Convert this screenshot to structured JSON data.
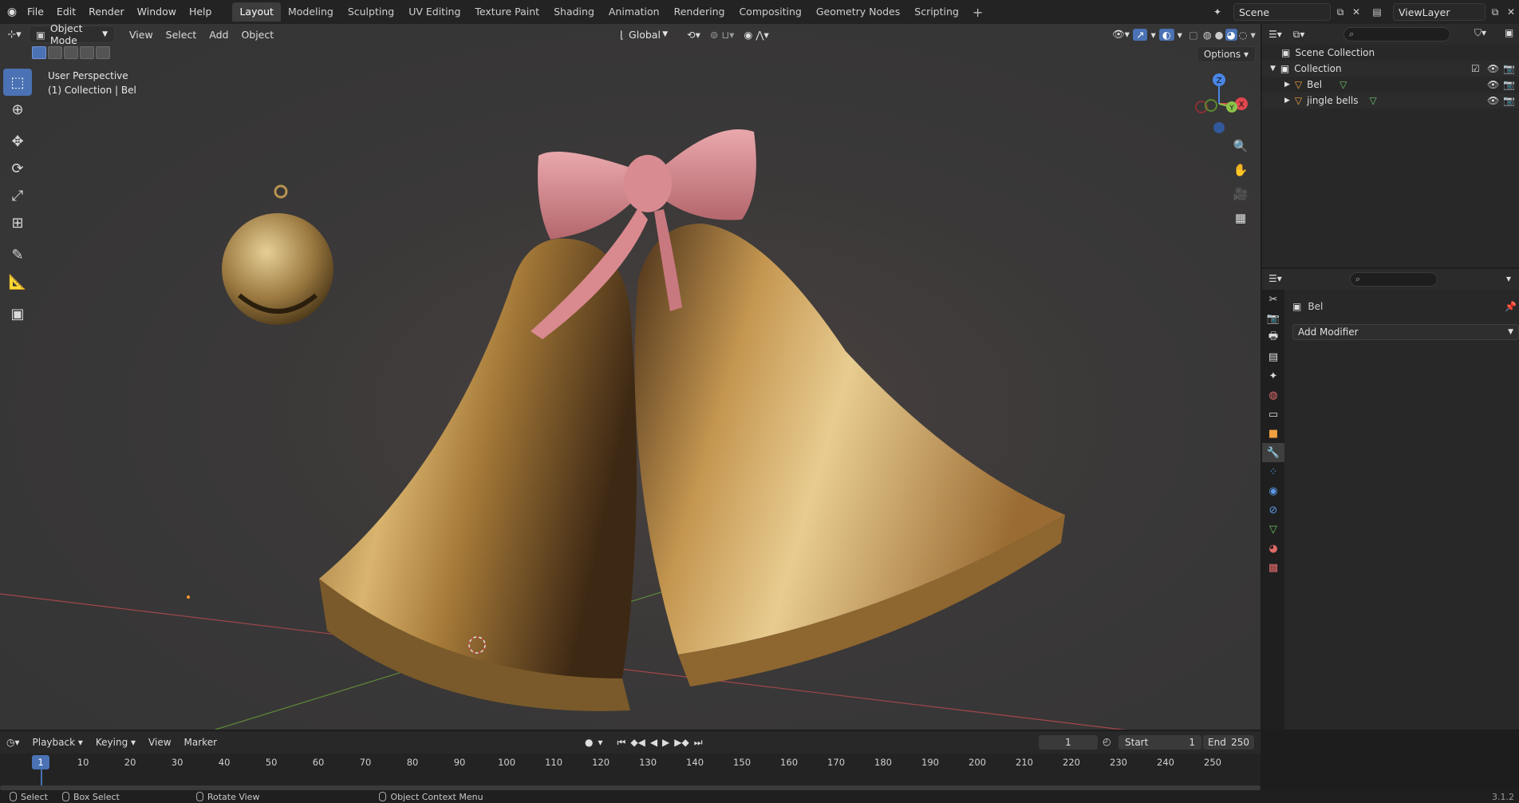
{
  "topbar": {
    "menus": [
      "File",
      "Edit",
      "Render",
      "Window",
      "Help"
    ],
    "workspaces": [
      "Layout",
      "Modeling",
      "Sculpting",
      "UV Editing",
      "Texture Paint",
      "Shading",
      "Animation",
      "Rendering",
      "Compositing",
      "Geometry Nodes",
      "Scripting"
    ],
    "active_workspace": "Layout",
    "scene": "Scene",
    "view_layer": "ViewLayer"
  },
  "viewport": {
    "mode": "Object Mode",
    "menus": [
      "View",
      "Select",
      "Add",
      "Object"
    ],
    "transform_orientation": "Global",
    "options_label": "Options",
    "info_line1": "User Perspective",
    "info_line2": "(1) Collection | Bel",
    "gizmo_axis_z": "Z",
    "gizmo_axis_y": "Y",
    "gizmo_axis_x": "X"
  },
  "outliner": {
    "root": "Scene Collection",
    "collection": "Collection",
    "items": [
      "Bel",
      "jingle bells"
    ]
  },
  "properties": {
    "object_name": "Bel",
    "add_modifier": "Add Modifier"
  },
  "timeline": {
    "menus": [
      "Playback",
      "Keying",
      "View",
      "Marker"
    ],
    "current_frame": "1",
    "start_label": "Start",
    "start_value": "1",
    "end_label": "End",
    "end_value": "250",
    "ticks": [
      "1",
      "10",
      "20",
      "30",
      "40",
      "50",
      "60",
      "70",
      "80",
      "90",
      "100",
      "110",
      "120",
      "130",
      "140",
      "150",
      "160",
      "170",
      "180",
      "190",
      "200",
      "210",
      "220",
      "230",
      "240",
      "250"
    ]
  },
  "statusbar": {
    "select": "Select",
    "box_select": "Box Select",
    "rotate_view": "Rotate View",
    "context_menu": "Object Context Menu",
    "version": "3.1.2"
  },
  "colors": {
    "accent": "#4a72b4",
    "x_axis": "#e0474f",
    "y_axis": "#8bc34a",
    "z_axis": "#4a86e8",
    "gold": "#b58a3c",
    "bow": "#d98a8e"
  }
}
